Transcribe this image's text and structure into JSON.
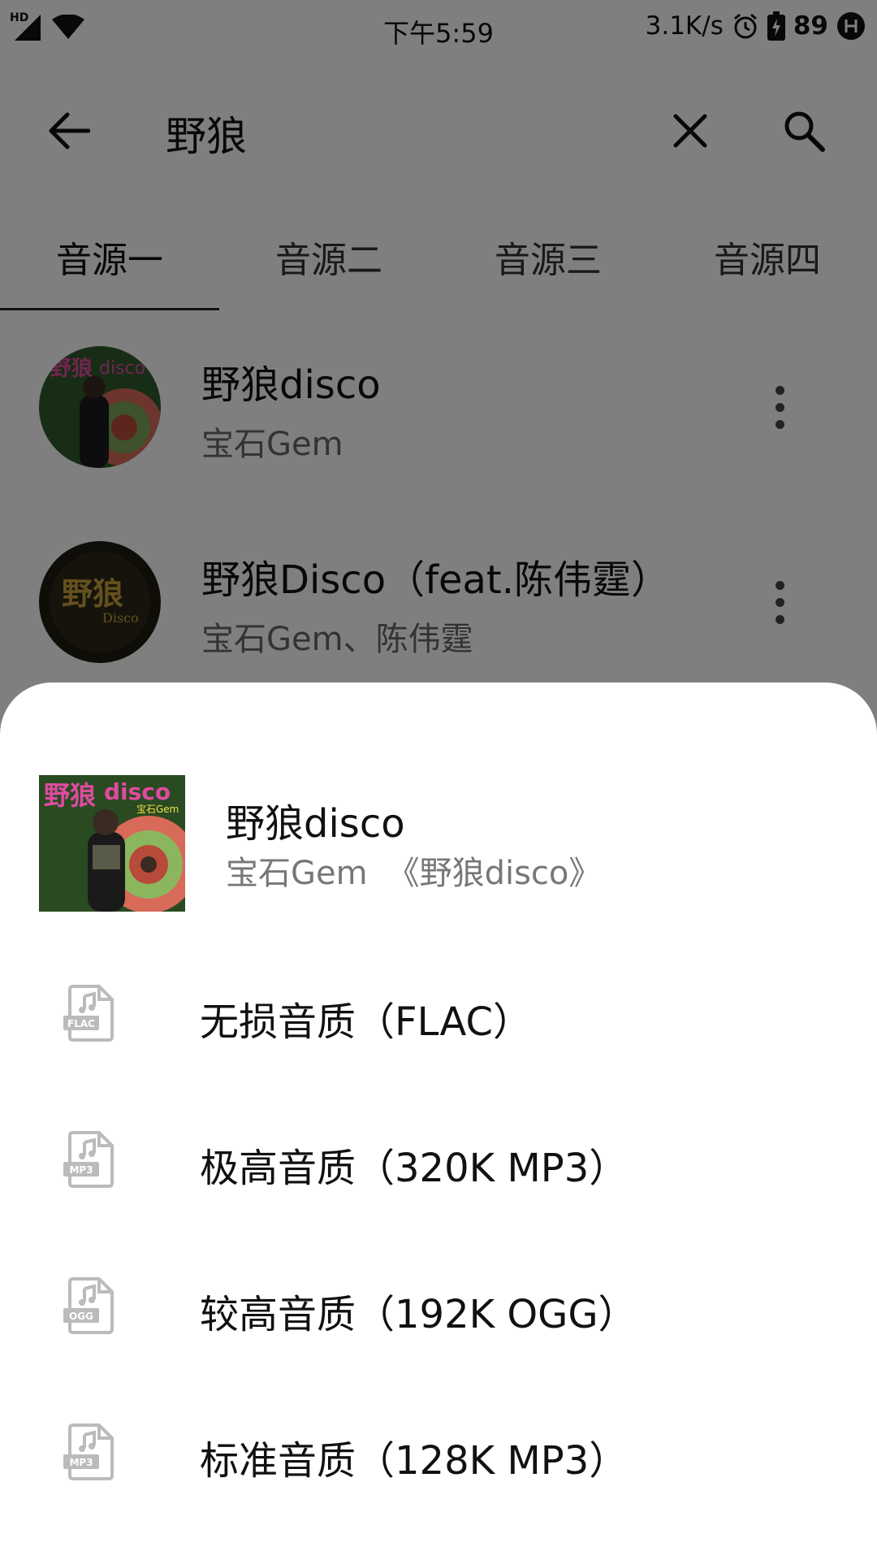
{
  "status_bar": {
    "hd": "HD",
    "time": "下午5:59",
    "net_speed": "3.1K/s",
    "battery": "89"
  },
  "search": {
    "query": "野狼"
  },
  "tabs": [
    {
      "label": "音源一"
    },
    {
      "label": "音源二"
    },
    {
      "label": "音源三"
    },
    {
      "label": "音源四"
    }
  ],
  "results": [
    {
      "title": "野狼disco",
      "artist": "宝石Gem"
    },
    {
      "title": "野狼Disco（feat.陈伟霆）",
      "artist": "宝石Gem、陈伟霆"
    }
  ],
  "sheet": {
    "title": "野狼disco",
    "artist": "宝石Gem",
    "album": "《野狼disco》",
    "options": [
      {
        "label": "无损音质（FLAC）",
        "icon": "flac-file-icon",
        "badge": "FLAC"
      },
      {
        "label": "极高音质（320K MP3）",
        "icon": "mp3-file-icon",
        "badge": "MP3"
      },
      {
        "label": "较高音质（192K OGG）",
        "icon": "ogg-file-icon",
        "badge": "OGG"
      },
      {
        "label": "标准音质（128K MP3）",
        "icon": "mp3-file-icon",
        "badge": "MP3"
      }
    ]
  },
  "colors": {
    "scrim": "#000000",
    "sheet_bg": "#ffffff",
    "text_primary": "#111111",
    "text_secondary": "#777777"
  }
}
